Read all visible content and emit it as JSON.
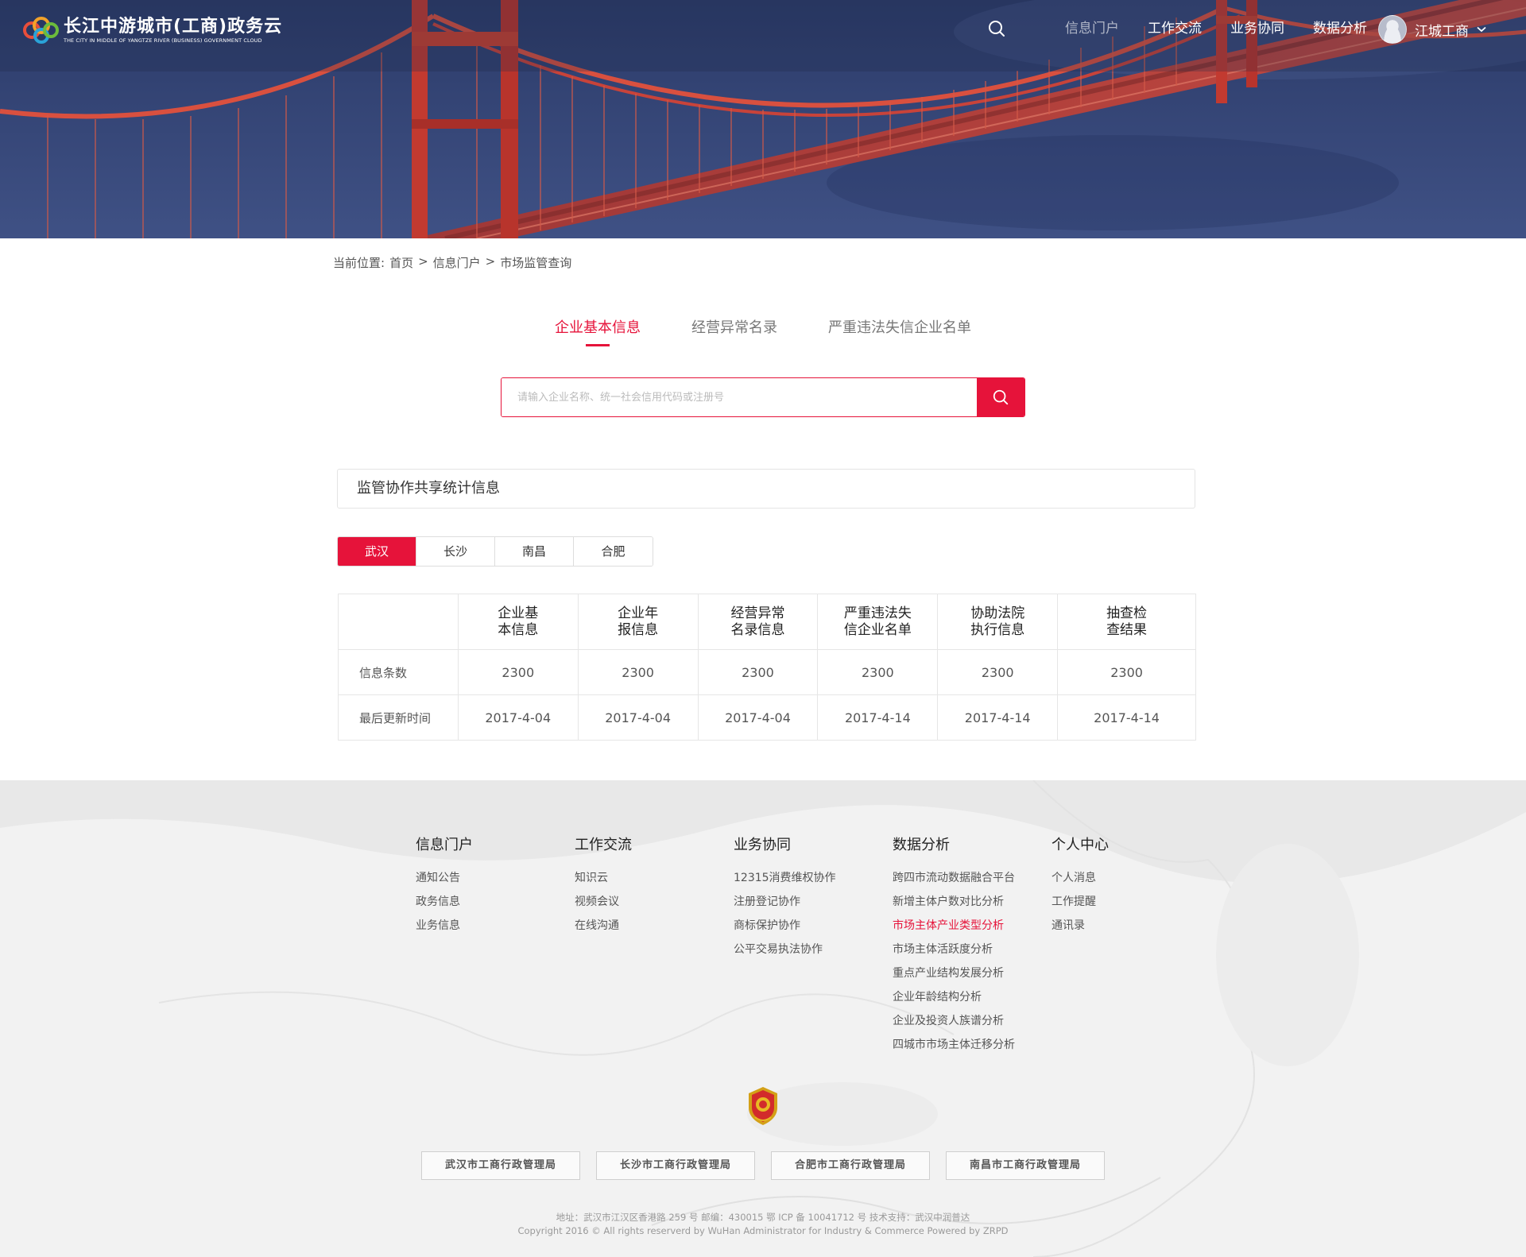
{
  "header": {
    "logo_title": "长江中游城市(工商)政务云",
    "logo_subtitle": "THE CITY IN MIDDLE OF YANGTZE RIVER (BUSINESS) GOVERNMENT CLOUD",
    "nav": [
      "信息门户",
      "工作交流",
      "业务协同",
      "数据分析"
    ],
    "active_nav": "信息门户",
    "user_name": "江城工商"
  },
  "breadcrumb": {
    "prefix": "当前位置:",
    "items": [
      "首页",
      "信息门户",
      "市场监管查询"
    ],
    "separator": ">"
  },
  "tabs": [
    "企业基本信息",
    "经营异常名录",
    "严重违法失信企业名单"
  ],
  "active_tab": "企业基本信息",
  "search": {
    "placeholder": "请输入企业名称、统一社会信用代码或注册号",
    "value": ""
  },
  "stats": {
    "title": "监管协作共享统计信息",
    "cities": [
      "武汉",
      "长沙",
      "南昌",
      "合肥"
    ],
    "active_city": "武汉",
    "columns": [
      [
        "企业基",
        "本信息"
      ],
      [
        "企业年",
        "报信息"
      ],
      [
        "经营异常",
        "名录信息"
      ],
      [
        "严重违法失",
        "信企业名单"
      ],
      [
        "协助法院",
        "执行信息"
      ],
      [
        "抽查检",
        "查结果"
      ]
    ],
    "rows": [
      {
        "label": "信息条数",
        "values": [
          "2300",
          "2300",
          "2300",
          "2300",
          "2300",
          "2300"
        ]
      },
      {
        "label": "最后更新时间",
        "values": [
          "2017-4-04",
          "2017-4-04",
          "2017-4-04",
          "2017-4-14",
          "2017-4-14",
          "2017-4-14"
        ]
      }
    ]
  },
  "footer": {
    "columns": [
      {
        "title": "信息门户",
        "links": [
          "通知公告",
          "政务信息",
          "业务信息"
        ]
      },
      {
        "title": "工作交流",
        "links": [
          "知识云",
          "视频会议",
          "在线沟通"
        ]
      },
      {
        "title": "业务协同",
        "links": [
          "12315消费维权协作",
          "注册登记协作",
          "商标保护协作",
          "公平交易执法协作"
        ]
      },
      {
        "title": "数据分析",
        "links": [
          "跨四市流动数据融合平台",
          "新增主体户数对比分析",
          "市场主体产业类型分析",
          "市场主体活跃度分析",
          "重点产业结构发展分析",
          "企业年龄结构分析",
          "企业及投资人族谱分析",
          "四城市市场主体迁移分析"
        ]
      },
      {
        "title": "个人中心",
        "links": [
          "个人消息",
          "工作提醒",
          "通讯录"
        ]
      }
    ],
    "highlighted_link": "市场主体产业类型分析",
    "agencies": [
      "武汉市工商行政管理局",
      "长沙市工商行政管理局",
      "合肥市工商行政管理局",
      "南昌市工商行政管理局"
    ],
    "address_line": "地址：武汉市江汉区香港路 259 号    邮编：430015    鄂 ICP 备 10041712 号    技术支持：武汉中润普达",
    "copyright_line": "Copyright 2016 © All rights reserverd by WuHan Administrator for Industry & Commerce    Powered by ZRPD"
  },
  "colors": {
    "accent": "#e6133a",
    "hero_blue": "#35467a",
    "bridge_red": "#c7352f",
    "footer_bg": "#f2f2f2"
  }
}
